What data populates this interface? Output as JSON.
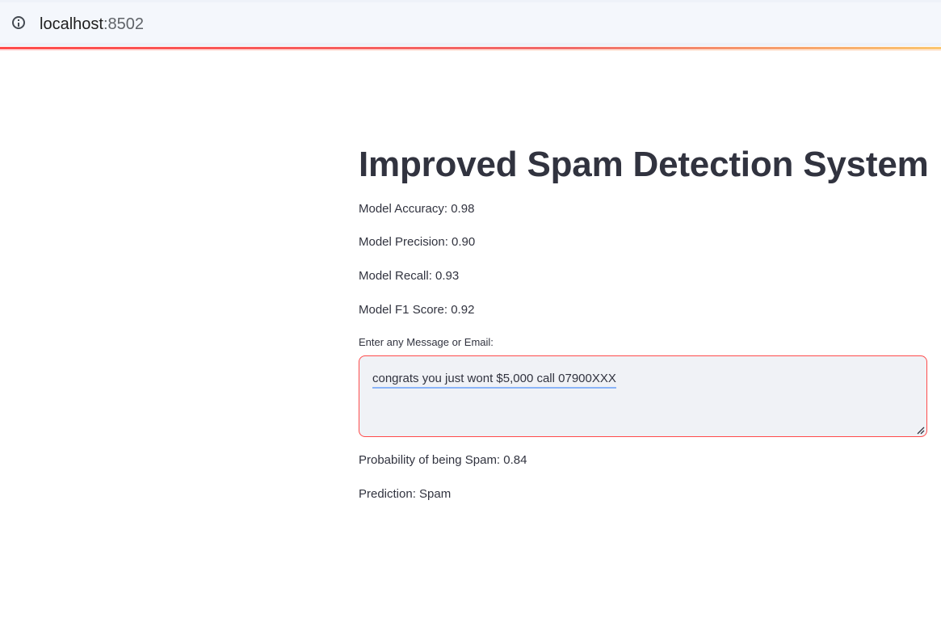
{
  "browser": {
    "host": "localhost",
    "port": ":8502",
    "info_icon": "info-icon"
  },
  "app": {
    "title": "Improved Spam Detection System",
    "metrics": {
      "accuracy": "Model Accuracy: 0.98",
      "precision": "Model Precision: 0.90",
      "recall": "Model Recall: 0.93",
      "f1": "Model F1 Score: 0.92"
    },
    "input": {
      "label": "Enter any Message or Email:",
      "value": "congrats you just wont $5,000 call 07900XXX"
    },
    "results": {
      "probability": "Probability of being Spam: 0.84",
      "prediction": "Prediction: Spam"
    }
  },
  "colors": {
    "accent": "#ff4b4b",
    "text": "#31333f",
    "input_bg": "#f0f2f6"
  }
}
